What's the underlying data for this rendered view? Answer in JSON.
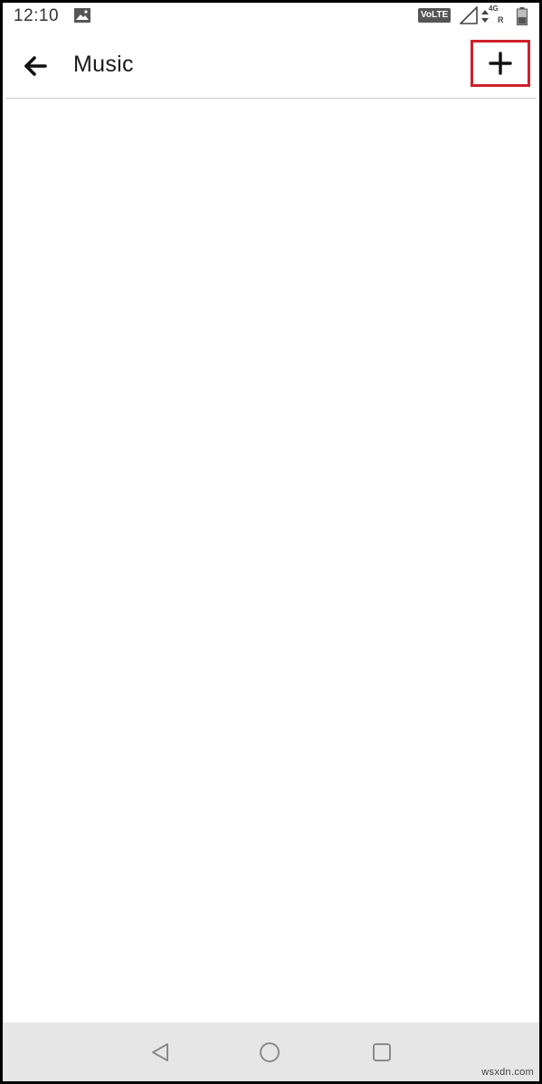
{
  "status_bar": {
    "time": "12:10",
    "volte_label": "VoLTE",
    "network_type": "4G",
    "network_roaming": "R",
    "icons": [
      "gallery-icon",
      "signal-icon",
      "data-arrows-icon",
      "battery-icon"
    ]
  },
  "app_bar": {
    "title": "Music",
    "back_icon": "arrow-left-icon",
    "add_icon": "plus-icon",
    "highlight_color": "#d0212c"
  },
  "nav_bar": {
    "icons": [
      "triangle-back-icon",
      "circle-home-icon",
      "square-recents-icon"
    ]
  },
  "watermark": "wsxdn.com"
}
